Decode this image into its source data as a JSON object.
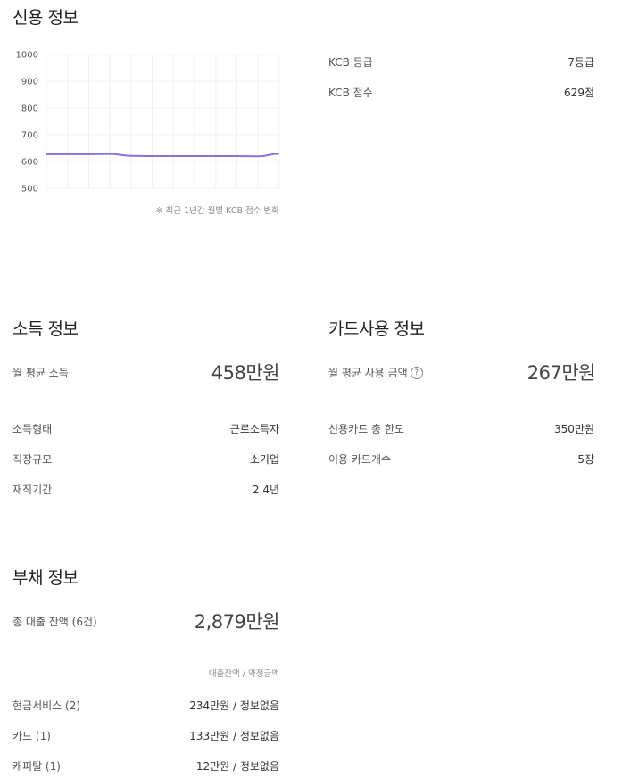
{
  "credit": {
    "title": "신용 정보",
    "grade_label": "KCB 등급",
    "grade_value": "7등급",
    "score_label": "KCB 점수",
    "score_value": "629점",
    "chart_note": "※ 최근 1년간 월별 KCB 점수 변화"
  },
  "chart_data": {
    "type": "line",
    "title": "",
    "xlabel": "",
    "ylabel": "",
    "ylim": [
      500,
      1000
    ],
    "yticks": [
      "1000",
      "900",
      "800",
      "700",
      "600",
      "500"
    ],
    "x": [
      0,
      1,
      2,
      3,
      4,
      5,
      6,
      7,
      8,
      9,
      10,
      11
    ],
    "series": [
      {
        "values": [
          627,
          627,
          627,
          628,
          621,
          620,
          620,
          620,
          620,
          620,
          619,
          629
        ]
      }
    ],
    "grid": true,
    "line_color": "#8a6fe0"
  },
  "income": {
    "title": "소득 정보",
    "avg_label": "월 평균 소득",
    "avg_value": "458만원",
    "rows": [
      {
        "label": "소득형태",
        "value": "근로소득자"
      },
      {
        "label": "직장규모",
        "value": "소기업"
      },
      {
        "label": "재직기간",
        "value": "2.4년"
      }
    ]
  },
  "card": {
    "title": "카드사용 정보",
    "avg_label": "월 평균 사용 금액",
    "help_glyph": "?",
    "avg_value": "267만원",
    "rows": [
      {
        "label": "신용카드 총 한도",
        "value": "350만원"
      },
      {
        "label": "이용 카드개수",
        "value": "5장"
      }
    ]
  },
  "debt": {
    "title": "부채 정보",
    "total_label": "총 대출 잔액 (6건)",
    "total_value": "2,879만원",
    "note": "대출잔액 / 약정금액",
    "rows": [
      {
        "label": "현금서비스 (2)",
        "value": "234만원 / 정보없음"
      },
      {
        "label": "카드 (1)",
        "value": "133만원 / 정보없음"
      },
      {
        "label": "캐피탈 (1)",
        "value": "12만원 / 정보없음"
      }
    ]
  }
}
